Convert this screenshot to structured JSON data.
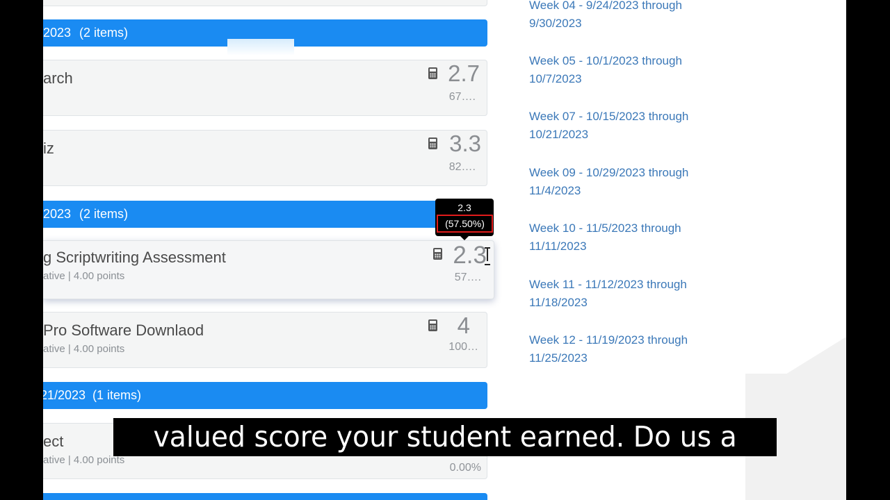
{
  "groups": [
    {
      "date_fragment": "2023",
      "count": "(2 items)"
    },
    {
      "date_fragment": "2023",
      "count": "(2 items)"
    },
    {
      "date_fragment": "21/2023",
      "count": "(1 items)"
    }
  ],
  "cards": [
    {
      "title": "arch",
      "meta": "",
      "score": "2.7",
      "pct": "67…."
    },
    {
      "title": "iz",
      "meta": "",
      "score": "3.3",
      "pct": "82…."
    },
    {
      "title": "g Scriptwriting Assessment",
      "meta": "ative | 4.00 points",
      "score": "2.3",
      "pct": "57…."
    },
    {
      "title": "Pro Software Downlaod",
      "meta": "ative | 4.00 points",
      "score": "4",
      "pct": "100…"
    },
    {
      "title": "ect",
      "meta": "ative | 4.00 points",
      "score": "",
      "pct": "0.00%"
    }
  ],
  "tooltip": {
    "score": "2.3",
    "pct": "(57.50%)"
  },
  "weeks": [
    {
      "line1": "Week 04 - 9/24/2023 through",
      "line2": "9/30/2023"
    },
    {
      "line1": "Week 05 - 10/1/2023 through",
      "line2": "10/7/2023"
    },
    {
      "line1": "Week 07 - 10/15/2023 through",
      "line2": "10/21/2023"
    },
    {
      "line1": "Week 09 - 10/29/2023 through",
      "line2": "11/4/2023"
    },
    {
      "line1": "Week 10 - 11/5/2023 through",
      "line2": "11/11/2023"
    },
    {
      "line1": "Week 11 - 11/12/2023 through",
      "line2": "11/18/2023"
    },
    {
      "line1": "Week 12 - 11/19/2023 through",
      "line2": "11/25/2023"
    }
  ],
  "caption": "valued score your student earned. Do us a",
  "colors": {
    "group_bar": "#1a8bf2",
    "link": "#3b78b8",
    "tooltip_border": "#e11b1b"
  }
}
